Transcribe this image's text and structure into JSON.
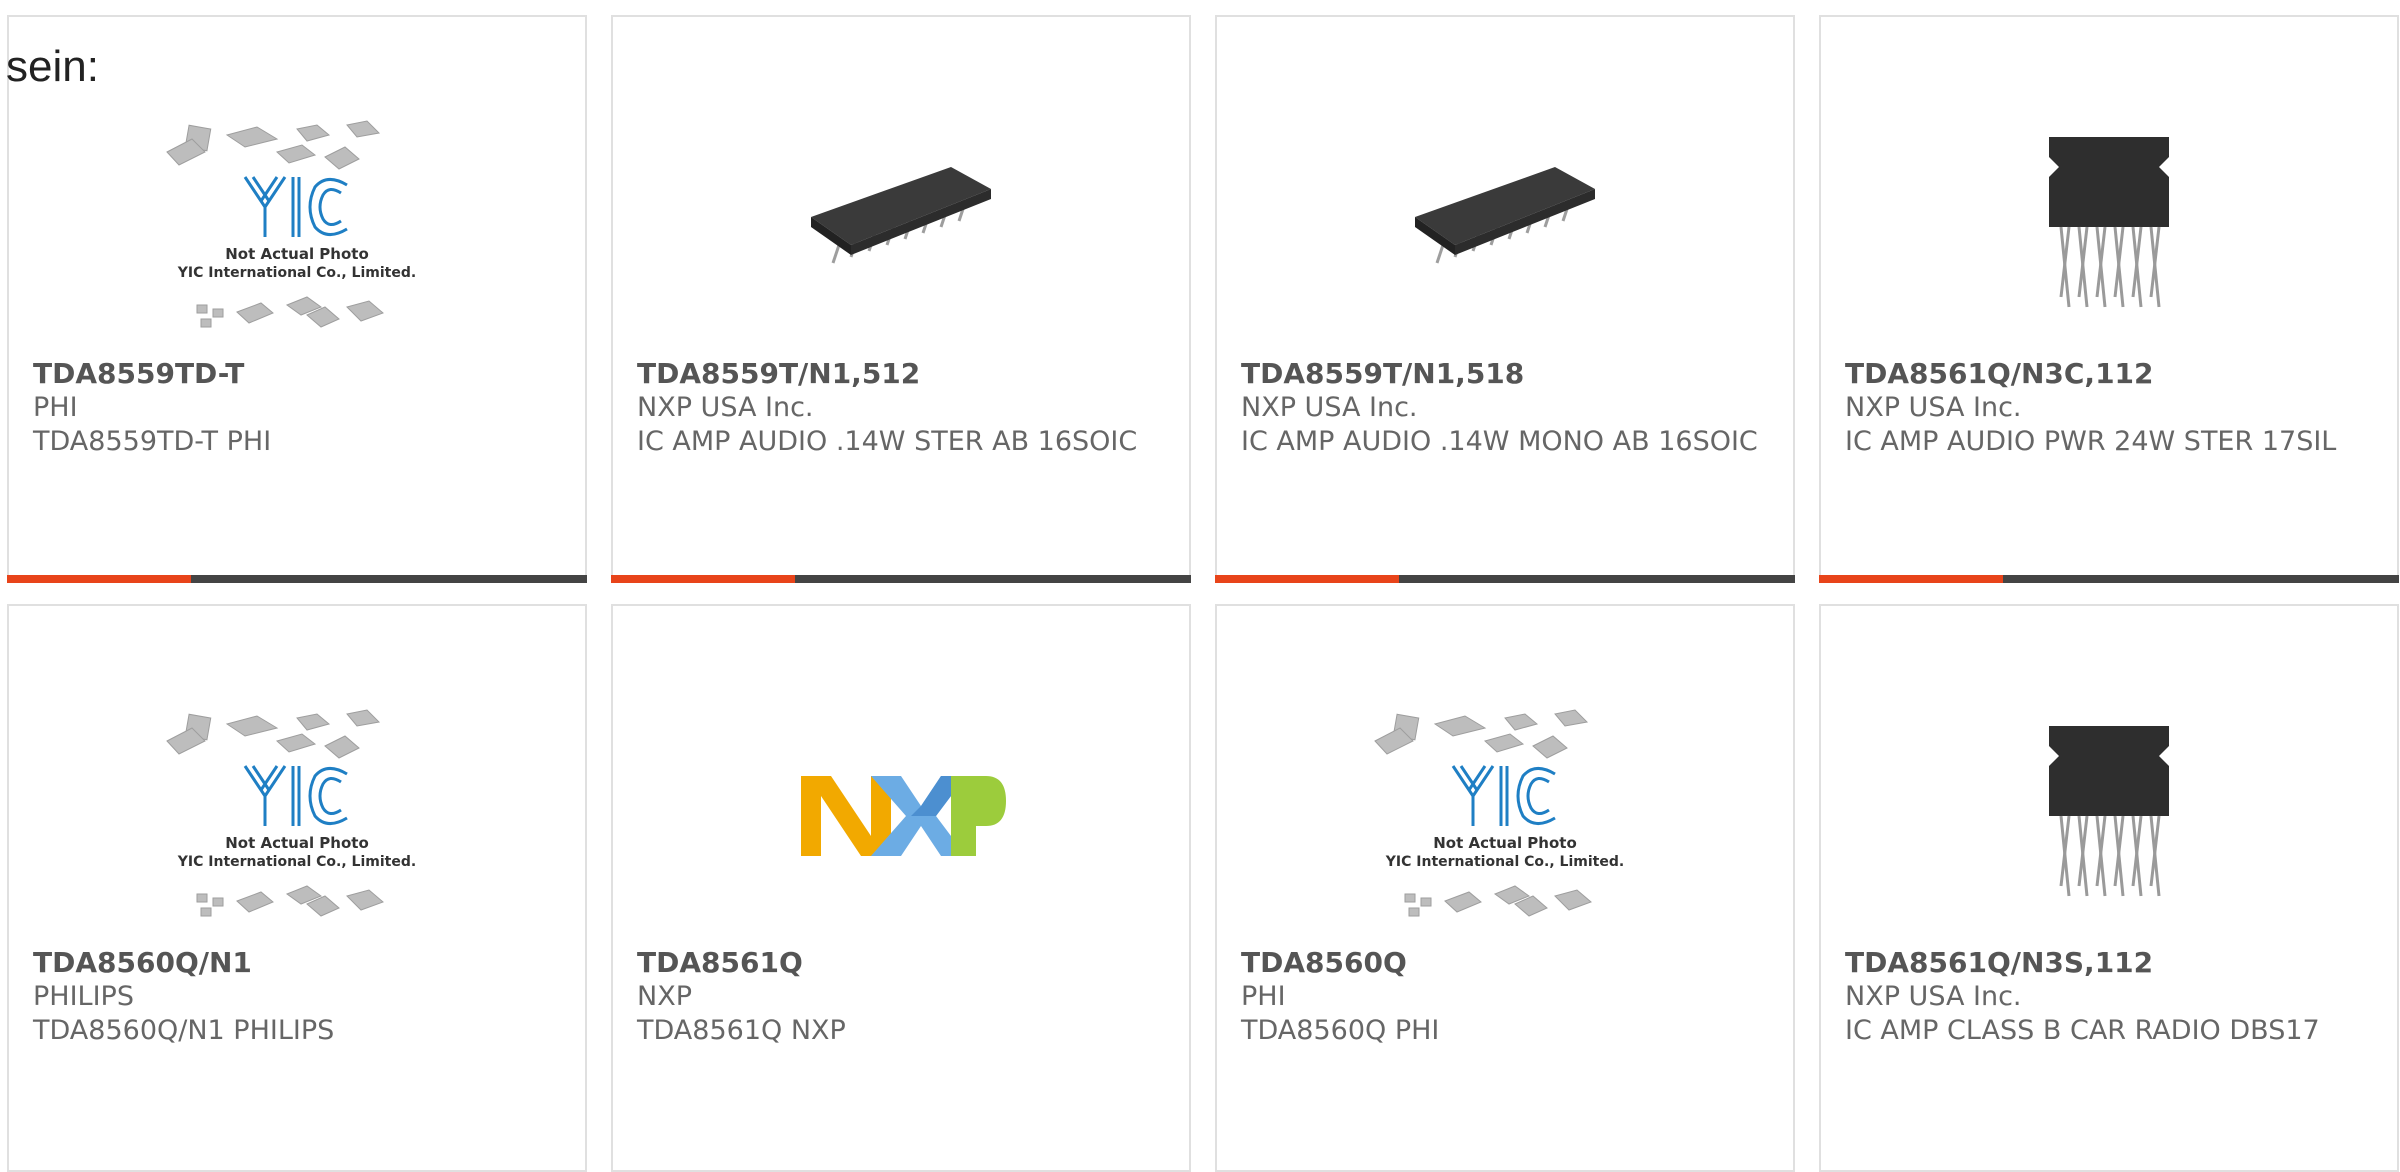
{
  "intro_text": "sein:",
  "brand_colors": {
    "accent": "#e8441a",
    "bar": "#444444",
    "yic_blue": "#1f7fc4"
  },
  "placeholder_text": {
    "line1": "Not Actual Photo",
    "line2": "YIC International Co., Limited."
  },
  "nxp_logo_text": "NXP",
  "products": [
    {
      "part": "TDA8559TD-T",
      "mfr": "PHI",
      "desc": "TDA8559TD-T PHI",
      "image": "yic-placeholder"
    },
    {
      "part": "TDA8559T/N1,512",
      "mfr": "NXP USA Inc.",
      "desc": "IC AMP AUDIO .14W STER AB 16SOIC",
      "image": "soic-chip"
    },
    {
      "part": "TDA8559T/N1,518",
      "mfr": "NXP USA Inc.",
      "desc": "IC AMP AUDIO .14W MONO AB 16SOIC",
      "image": "soic-chip"
    },
    {
      "part": "TDA8561Q/N3C,112",
      "mfr": "NXP USA Inc.",
      "desc": "IC AMP AUDIO PWR 24W STER 17SIL",
      "image": "sil-chip"
    },
    {
      "part": "TDA8560Q/N1",
      "mfr": "PHILIPS",
      "desc": "TDA8560Q/N1 PHILIPS",
      "image": "yic-placeholder"
    },
    {
      "part": "TDA8561Q",
      "mfr": "NXP",
      "desc": "TDA8561Q NXP",
      "image": "nxp-logo"
    },
    {
      "part": "TDA8560Q",
      "mfr": "PHI",
      "desc": "TDA8560Q PHI",
      "image": "yic-placeholder"
    },
    {
      "part": "TDA8561Q/N3S,112",
      "mfr": "NXP USA Inc.",
      "desc": "IC AMP CLASS B CAR RADIO DBS17",
      "image": "sil-chip"
    }
  ]
}
